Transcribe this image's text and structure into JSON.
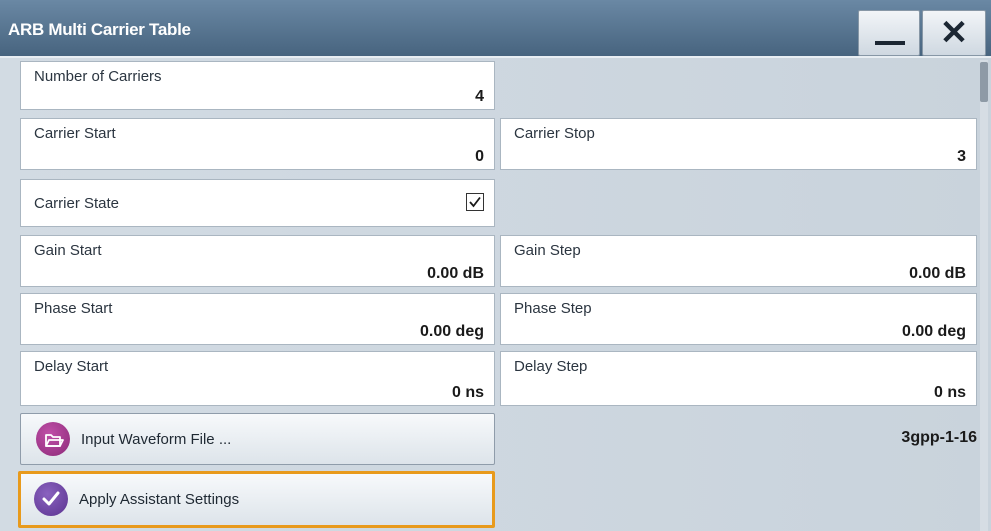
{
  "window": {
    "title": "ARB Multi Carrier Table",
    "minimize_icon": "minimize-icon",
    "close_icon": "close-icon",
    "close_glyph": "✕"
  },
  "fields": {
    "number_of_carriers": {
      "label": "Number of Carriers",
      "value": "4"
    },
    "carrier_start": {
      "label": "Carrier Start",
      "value": "0"
    },
    "carrier_stop": {
      "label": "Carrier Stop",
      "value": "3"
    },
    "carrier_state": {
      "label": "Carrier State",
      "checked": true,
      "icon": "checkmark-icon"
    },
    "gain_start": {
      "label": "Gain Start",
      "value": "0.00 dB"
    },
    "gain_step": {
      "label": "Gain Step",
      "value": "0.00 dB"
    },
    "phase_start": {
      "label": "Phase Start",
      "value": "0.00 deg"
    },
    "phase_step": {
      "label": "Phase Step",
      "value": "0.00 deg"
    },
    "delay_start": {
      "label": "Delay Start",
      "value": "0 ns"
    },
    "delay_step": {
      "label": "Delay Step",
      "value": "0 ns"
    }
  },
  "buttons": {
    "input_waveform": {
      "label": "Input Waveform File ...",
      "icon": "folder-icon"
    },
    "apply_assistant": {
      "label": "Apply Assistant Settings",
      "icon": "check-circle-icon"
    }
  },
  "waveform_file": {
    "value": "3gpp-1-16"
  },
  "colors": {
    "titlebar": "#47647f",
    "icon_purple": "#9b3a8a",
    "icon_violet": "#6a3f9b",
    "focus": "#e89a1c"
  }
}
